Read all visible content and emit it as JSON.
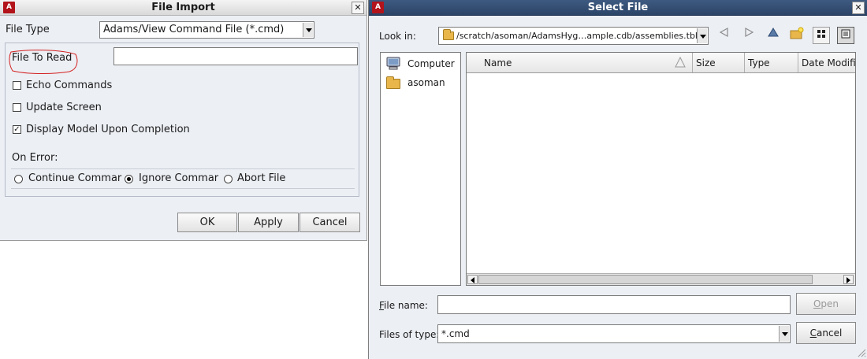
{
  "file_import": {
    "title": "File Import",
    "app_badge": "A",
    "close_glyph": "✕",
    "file_type_label": "File Type",
    "file_type_value": "Adams/View Command File (*.cmd)",
    "file_to_read_label": "File To Read",
    "file_to_read_value": "",
    "options": [
      {
        "label": "Echo Commands",
        "checked": false
      },
      {
        "label": "Update Screen",
        "checked": false
      },
      {
        "label": "Display Model Upon Completion",
        "checked": true
      }
    ],
    "on_error_label": "On Error:",
    "on_error_options": [
      {
        "label": "Continue Commar",
        "selected": false
      },
      {
        "label": "Ignore Commar",
        "selected": true
      },
      {
        "label": "Abort File",
        "selected": false
      }
    ],
    "buttons": {
      "ok": "OK",
      "apply": "Apply",
      "cancel": "Cancel"
    },
    "annotation_color": "#d32020"
  },
  "select_file": {
    "title": "Select File",
    "app_badge": "A",
    "close_glyph": "✕",
    "look_in_label": "Look in:",
    "look_in_path": "/scratch/asoman/AdamsHyg…ample.cdb/assemblies.tbl",
    "toolbar_icons": [
      "back-arrow-icon",
      "forward-arrow-icon",
      "up-folder-icon",
      "new-folder-icon",
      "icon-view-icon",
      "detail-view-icon"
    ],
    "places": [
      {
        "label": "Computer",
        "icon": "computer-icon"
      },
      {
        "label": "asoman",
        "icon": "folder-icon"
      }
    ],
    "columns": [
      "Name",
      "Size",
      "Type",
      "Date Modifie"
    ],
    "file_name_label": "File name:",
    "file_name_value": "",
    "files_of_type_label": "Files of type:",
    "files_of_type_value": "*.cmd",
    "open_label": "Open",
    "cancel_label": "Cancel"
  }
}
